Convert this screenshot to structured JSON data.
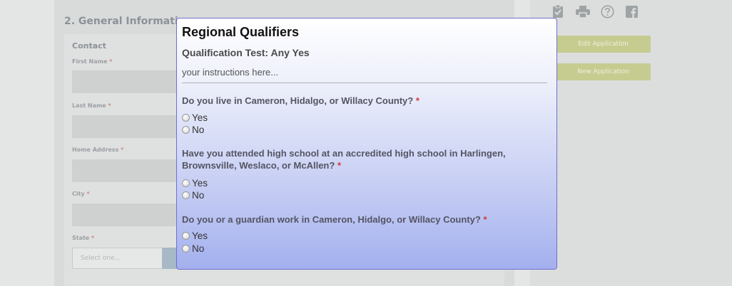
{
  "background": {
    "section_title": "2. General Information",
    "contact_heading": "Contact",
    "required_mark": "*",
    "fields": [
      {
        "label": "First Name"
      },
      {
        "label": "Last Name"
      },
      {
        "label": "Home Address"
      },
      {
        "label": "City"
      },
      {
        "label": "State"
      }
    ],
    "state_placeholder": "Select one...",
    "sidebar": {
      "icons": [
        "clipboard-check-icon",
        "print-icon",
        "help-icon",
        "facebook-icon"
      ],
      "edit_button": "Edit Application",
      "new_button": "New Application"
    }
  },
  "modal": {
    "title": "Regional Qualifiers",
    "subtitle": "Qualification Test: Any Yes",
    "instructions": "your instructions here...",
    "required_mark": "*",
    "questions": [
      {
        "text": "Do you live in Cameron, Hidalgo, or Willacy County?",
        "options": [
          "Yes",
          "No"
        ],
        "selected": null
      },
      {
        "text": "Have you attended high school at an accredited high school in Harlingen, Brownsville, Weslaco, or McAllen?",
        "options": [
          "Yes",
          "No"
        ],
        "selected": null
      },
      {
        "text": "Do you or a guardian work in Cameron, Hidalgo, or Willacy County?",
        "options": [
          "Yes",
          "No"
        ],
        "selected": null
      }
    ]
  },
  "colors": {
    "modal_border": "#6f6fcf",
    "modal_gradient_bottom": "#a3b0ee",
    "required_star": "#d23b3b",
    "sidebar_button": "#c6cc90"
  }
}
